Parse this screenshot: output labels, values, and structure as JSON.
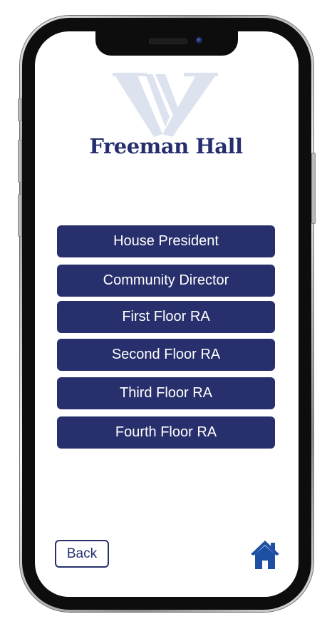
{
  "app": {
    "hall_name": "Freeman Hall",
    "logo_letter": "W"
  },
  "roles": [
    {
      "label": "House President"
    },
    {
      "label": "Community Director"
    },
    {
      "label": "First Floor RA"
    },
    {
      "label": "Second Floor RA"
    },
    {
      "label": "Third Floor RA"
    },
    {
      "label": "Fourth Floor RA"
    }
  ],
  "footer": {
    "back_label": "Back",
    "home_icon": "home-icon"
  },
  "colors": {
    "brand_navy": "#27306c",
    "logo_watermark": "#dde2ef",
    "home_blue": "#1f4fa3"
  }
}
